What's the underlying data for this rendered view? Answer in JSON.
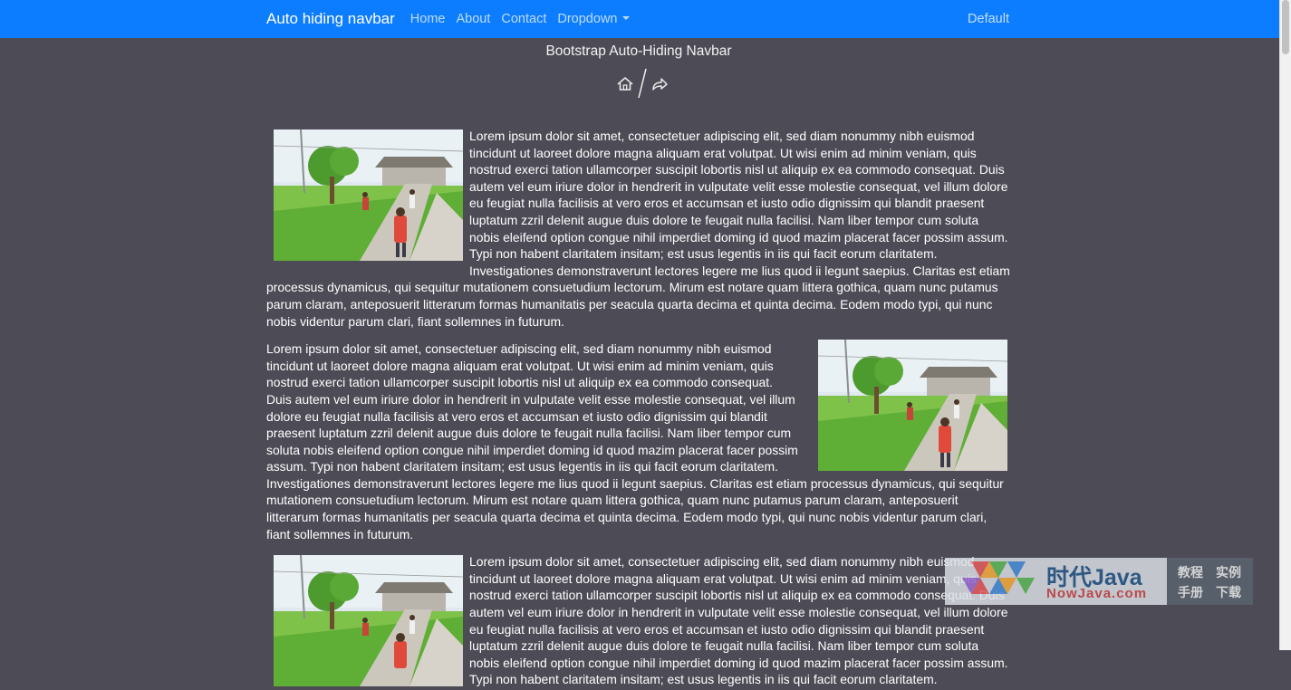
{
  "navbar": {
    "brand": "Auto hiding navbar",
    "links": [
      "Home",
      "About",
      "Contact",
      "Dropdown"
    ],
    "right": "Default",
    "color": "#0d7dff"
  },
  "page": {
    "title": "Bootstrap Auto-Hiding Navbar",
    "background": "#4d4b56",
    "breadcrumb_icons": [
      "home-icon",
      "share-icon"
    ]
  },
  "paragraphs": [
    {
      "image_side": "left",
      "text": "Lorem ipsum dolor sit amet, consectetuer adipiscing elit, sed diam nonummy nibh euismod tincidunt ut laoreet dolore magna aliquam erat volutpat. Ut wisi enim ad minim veniam, quis nostrud exerci tation ullamcorper suscipit lobortis nisl ut aliquip ex ea commodo consequat. Duis autem vel eum iriure dolor in hendrerit in vulputate velit esse molestie consequat, vel illum dolore eu feugiat nulla facilisis at vero eros et accumsan et iusto odio dignissim qui blandit praesent luptatum zzril delenit augue duis dolore te feugait nulla facilisi. Nam liber tempor cum soluta nobis eleifend option congue nihil imperdiet doming id quod mazim placerat facer possim assum. Typi non habent claritatem insitam; est usus legentis in iis qui facit eorum claritatem. Investigationes demonstraverunt lectores legere me lius quod ii legunt saepius. Claritas est etiam processus dynamicus, qui sequitur mutationem consuetudium lectorum. Mirum est notare quam littera gothica, quam nunc putamus parum claram, anteposuerit litterarum formas humanitatis per seacula quarta decima et quinta decima. Eodem modo typi, qui nunc nobis videntur parum clari, fiant sollemnes in futurum."
    },
    {
      "image_side": "right",
      "text": "Lorem ipsum dolor sit amet, consectetuer adipiscing elit, sed diam nonummy nibh euismod tincidunt ut laoreet dolore magna aliquam erat volutpat. Ut wisi enim ad minim veniam, quis nostrud exerci tation ullamcorper suscipit lobortis nisl ut aliquip ex ea commodo consequat. Duis autem vel eum iriure dolor in hendrerit in vulputate velit esse molestie consequat, vel illum dolore eu feugiat nulla facilisis at vero eros et accumsan et iusto odio dignissim qui blandit praesent luptatum zzril delenit augue duis dolore te feugait nulla facilisi. Nam liber tempor cum soluta nobis eleifend option congue nihil imperdiet doming id quod mazim placerat facer possim assum. Typi non habent claritatem insitam; est usus legentis in iis qui facit eorum claritatem. Investigationes demonstraverunt lectores legere me lius quod ii legunt saepius. Claritas est etiam processus dynamicus, qui sequitur mutationem consuetudium lectorum. Mirum est notare quam littera gothica, quam nunc putamus parum claram, anteposuerit litterarum formas humanitatis per seacula quarta decima et quinta decima. Eodem modo typi, qui nunc nobis videntur parum clari, fiant sollemnes in futurum."
    },
    {
      "image_side": "left",
      "text": "Lorem ipsum dolor sit amet, consectetuer adipiscing elit, sed diam nonummy nibh euismod tincidunt ut laoreet dolore magna aliquam erat volutpat. Ut wisi enim ad minim veniam, quis nostrud exerci tation ullamcorper suscipit lobortis nisl ut aliquip ex ea commodo consequat. Duis autem vel eum iriure dolor in hendrerit in vulputate velit esse molestie consequat, vel illum dolore eu feugiat nulla facilisis at vero eros et accumsan et iusto odio dignissim qui blandit praesent luptatum zzril delenit augue duis dolore te feugait nulla facilisi. Nam liber tempor cum soluta nobis eleifend option congue nihil imperdiet doming id quod mazim placerat facer possim assum. Typi non habent claritatem insitam; est usus legentis in iis qui facit eorum claritatem."
    }
  ],
  "watermark": {
    "title": "时代Java",
    "subtitle": "NowJava.com",
    "links": [
      "教程",
      "实例",
      "手册",
      "下载"
    ]
  }
}
